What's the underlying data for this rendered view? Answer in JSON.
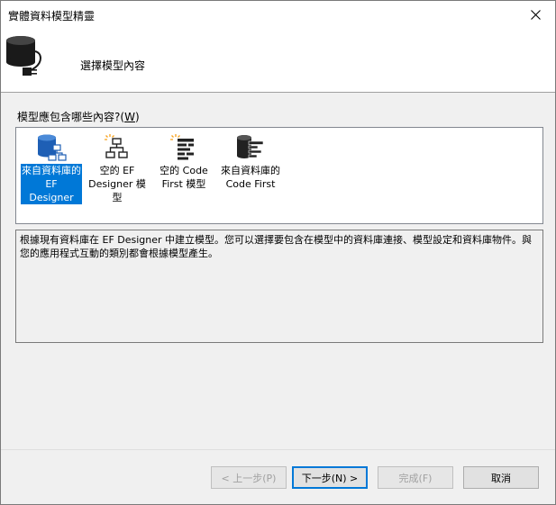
{
  "window": {
    "title": "實體資料模型精靈",
    "close_icon": "close-icon"
  },
  "header": {
    "title": "選擇模型內容",
    "icon": "database-plug-icon"
  },
  "question": {
    "label": "模型應包含哪些內容?",
    "mnemonic_open": "(",
    "mnemonic_key": "W",
    "mnemonic_close": ")"
  },
  "model_options": [
    {
      "label": "來自資料庫的 EF Designer",
      "icon": "database-designer-icon",
      "selected": true
    },
    {
      "label": "空的 EF Designer 模型",
      "icon": "empty-designer-icon",
      "selected": false
    },
    {
      "label": "空的 Code First 模型",
      "icon": "empty-code-first-icon",
      "selected": false
    },
    {
      "label": "來自資料庫的 Code First",
      "icon": "database-code-first-icon",
      "selected": false
    }
  ],
  "description": "根據現有資料庫在 EF Designer 中建立模型。您可以選擇要包含在模型中的資料庫連接、模型設定和資料庫物件。與您的應用程式互動的類別都會根據模型產生。",
  "buttons": {
    "back": "< 上一步(P)",
    "next": "下一步(N) >",
    "finish": "完成(F)",
    "cancel": "取消"
  },
  "colors": {
    "selection": "#0078d7",
    "accent_orange": "#f7a21b",
    "icon_blue": "#1e5fb5"
  }
}
